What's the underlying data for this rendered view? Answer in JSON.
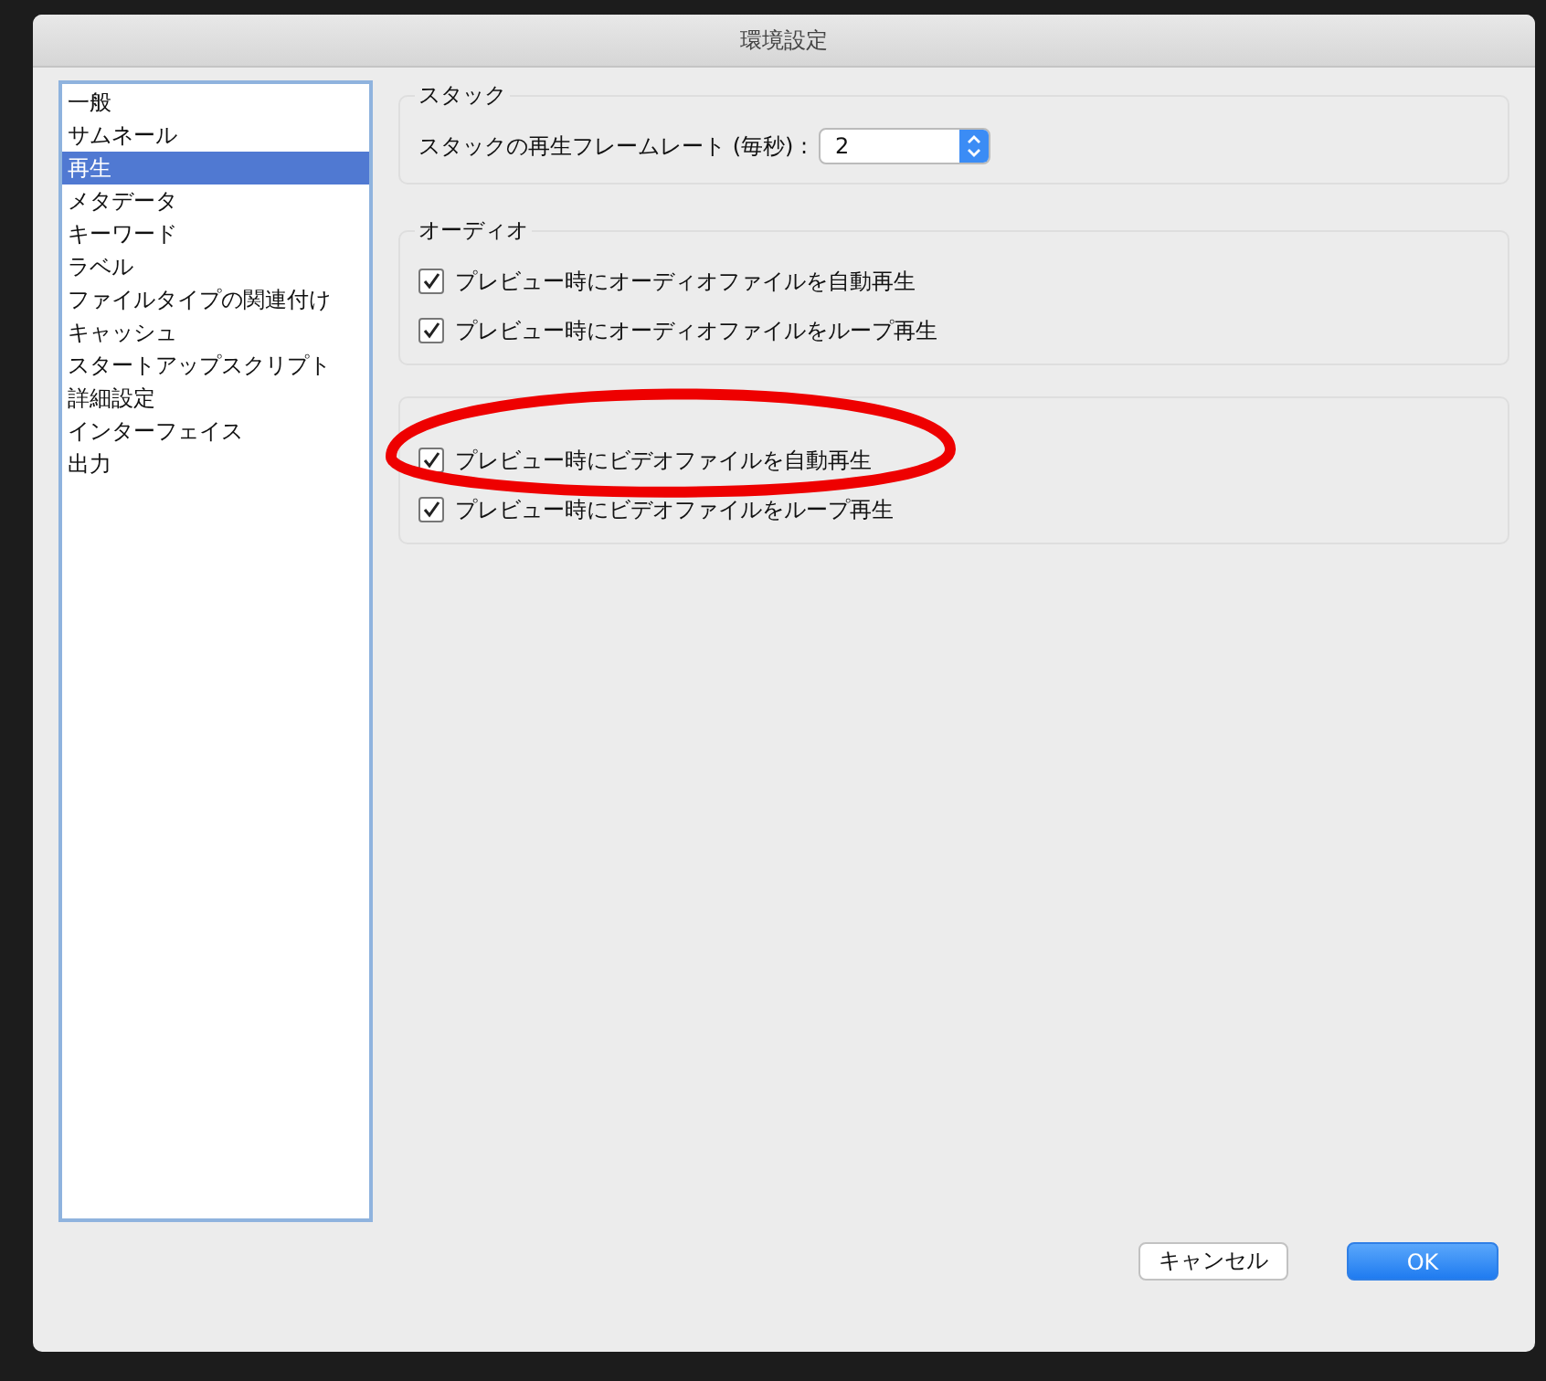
{
  "window": {
    "title": "環境設定"
  },
  "sidebar": {
    "items": [
      {
        "label": "一般",
        "selected": false
      },
      {
        "label": "サムネール",
        "selected": false
      },
      {
        "label": "再生",
        "selected": true
      },
      {
        "label": "メタデータ",
        "selected": false
      },
      {
        "label": "キーワード",
        "selected": false
      },
      {
        "label": "ラベル",
        "selected": false
      },
      {
        "label": "ファイルタイプの関連付け",
        "selected": false
      },
      {
        "label": "キャッシュ",
        "selected": false
      },
      {
        "label": "スタートアップスクリプト",
        "selected": false
      },
      {
        "label": "詳細設定",
        "selected": false
      },
      {
        "label": "インターフェイス",
        "selected": false
      },
      {
        "label": "出力",
        "selected": false
      }
    ]
  },
  "sections": [
    {
      "title": "スタック",
      "rows": [
        {
          "kind": "select",
          "label": "スタックの再生フレームレート (毎秒) :",
          "value": "2"
        }
      ]
    },
    {
      "title": "オーディオ",
      "rows": [
        {
          "kind": "checkbox",
          "label": "プレビュー時にオーディオファイルを自動再生",
          "checked": true
        },
        {
          "kind": "checkbox",
          "label": "プレビュー時にオーディオファイルをループ再生",
          "checked": true
        }
      ]
    },
    {
      "rows": [
        {
          "kind": "checkbox",
          "label": "プレビュー時にビデオファイルを自動再生",
          "checked": true
        },
        {
          "kind": "checkbox",
          "label": "プレビュー時にビデオファイルをループ再生",
          "checked": true
        }
      ]
    }
  ],
  "buttons": [
    {
      "label": "キャンセル",
      "kind": "secondary"
    },
    {
      "label": "OK",
      "kind": "primary"
    }
  ]
}
